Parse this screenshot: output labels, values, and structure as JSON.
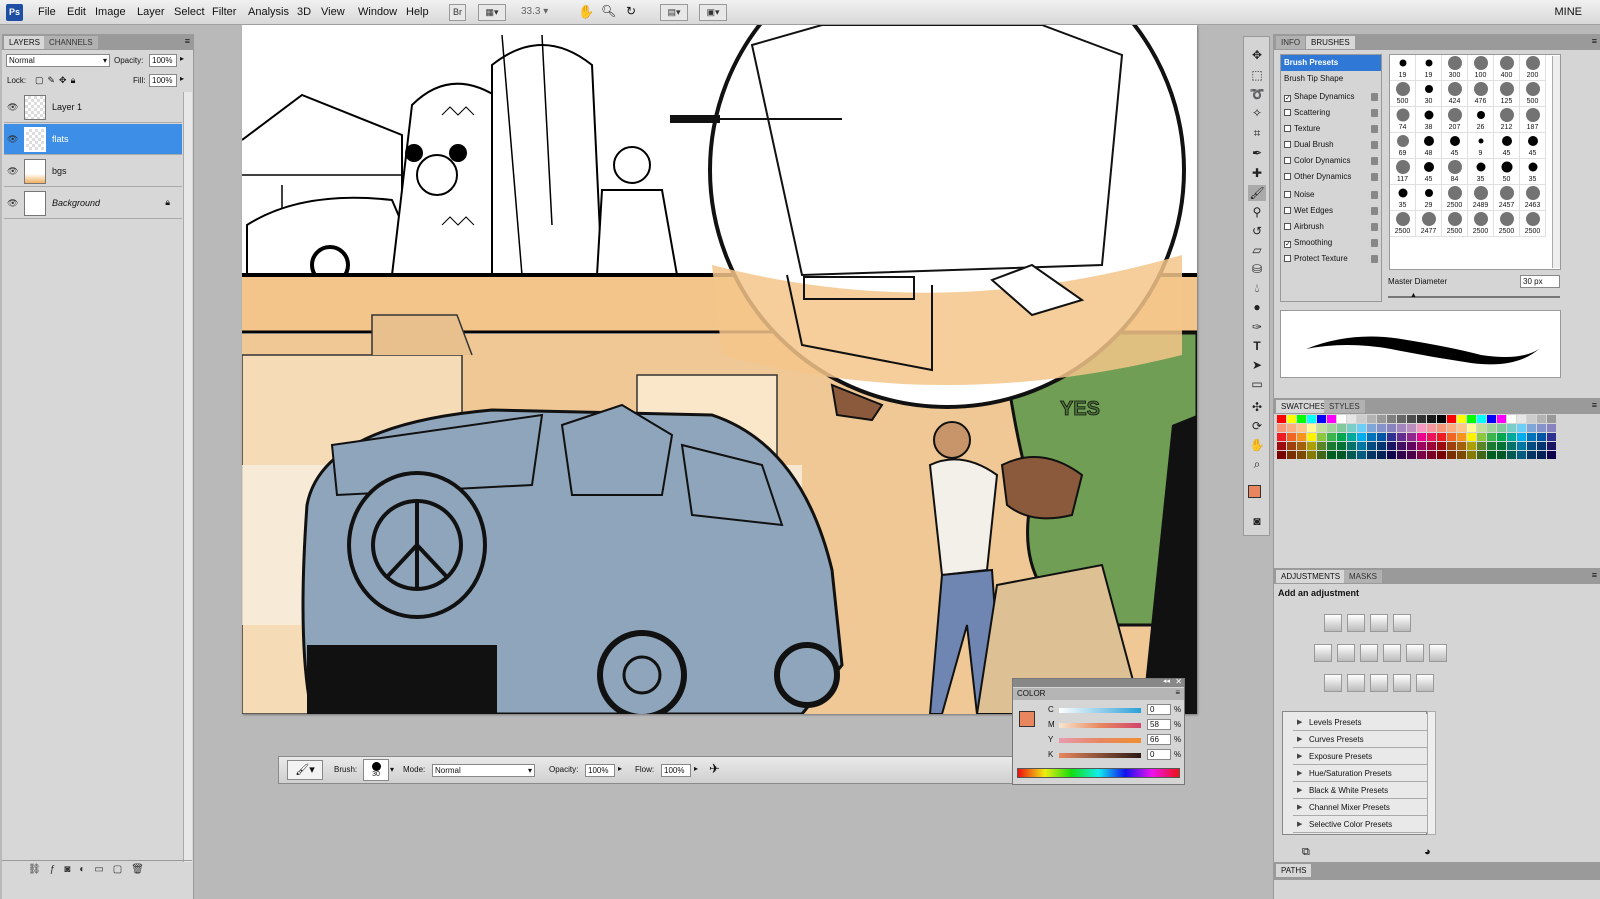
{
  "app": {
    "logo": "Ps",
    "workspace": "MINE"
  },
  "menu": [
    "File",
    "Edit",
    "Image",
    "Layer",
    "Select",
    "Filter",
    "Analysis",
    "3D",
    "View",
    "Window",
    "Help"
  ],
  "topbar": {
    "bridge": "Br",
    "zoom": "33.3"
  },
  "layers_panel": {
    "tabs": [
      "LAYERS",
      "CHANNELS"
    ],
    "blend_mode": "Normal",
    "opacity_label": "Opacity:",
    "opacity": "100%",
    "lock_label": "Lock:",
    "fill_label": "Fill:",
    "fill": "100%",
    "layers": [
      {
        "name": "Layer 1"
      },
      {
        "name": "flats"
      },
      {
        "name": "bgs"
      },
      {
        "name": "Background"
      }
    ]
  },
  "brushes_panel": {
    "tabs": [
      "INFO",
      "BRUSHES"
    ],
    "options": [
      {
        "label": "Brush Presets"
      },
      {
        "label": "Brush Tip Shape"
      },
      {
        "label": "Shape Dynamics",
        "checked": true
      },
      {
        "label": "Scattering",
        "checked": false
      },
      {
        "label": "Texture",
        "checked": false
      },
      {
        "label": "Dual Brush",
        "checked": false
      },
      {
        "label": "Color Dynamics",
        "checked": false
      },
      {
        "label": "Other Dynamics",
        "checked": false
      },
      {
        "label": "Noise",
        "checked": false
      },
      {
        "label": "Wet Edges",
        "checked": false
      },
      {
        "label": "Airbrush",
        "checked": false
      },
      {
        "label": "Smoothing",
        "checked": true
      },
      {
        "label": "Protect Texture",
        "checked": false
      }
    ],
    "sizes": [
      "19",
      "19",
      "300",
      "100",
      "400",
      "200",
      "500",
      "30",
      "424",
      "476",
      "125",
      "500",
      "74",
      "38",
      "207",
      "26",
      "212",
      "187",
      "69",
      "48",
      "45",
      "9",
      "45",
      "45",
      "117",
      "45",
      "84",
      "35",
      "50",
      "35",
      "35",
      "29",
      "2500",
      "2489",
      "2457",
      "2463",
      "2500",
      "2477",
      "2500",
      "2500",
      "2500",
      "2500"
    ],
    "master_diameter_label": "Master Diameter",
    "master_diameter": "30 px"
  },
  "swatches_panel": {
    "tabs": [
      "SWATCHES",
      "STYLES"
    ]
  },
  "adjustments_panel": {
    "tabs": [
      "ADJUSTMENTS",
      "MASKS"
    ],
    "title": "Add an adjustment",
    "presets": [
      "Levels Presets",
      "Curves Presets",
      "Exposure Presets",
      "Hue/Saturation Presets",
      "Black & White Presets",
      "Channel Mixer Presets",
      "Selective Color Presets"
    ]
  },
  "paths_panel": {
    "title": "PATHS"
  },
  "color_panel": {
    "title": "COLOR",
    "channels": [
      {
        "label": "C",
        "value": "0",
        "pct": "%"
      },
      {
        "label": "M",
        "value": "58",
        "pct": "%"
      },
      {
        "label": "Y",
        "value": "66",
        "pct": "%"
      },
      {
        "label": "K",
        "value": "0",
        "pct": "%"
      }
    ],
    "fg_color": "#e8875f"
  },
  "options_bar": {
    "brush_label": "Brush:",
    "brush_size": "30",
    "mode_label": "Mode:",
    "mode": "Normal",
    "opacity_label": "Opacity:",
    "opacity": "100%",
    "flow_label": "Flow:",
    "flow": "100%"
  },
  "canvas": {
    "shirt_text": "YES"
  }
}
